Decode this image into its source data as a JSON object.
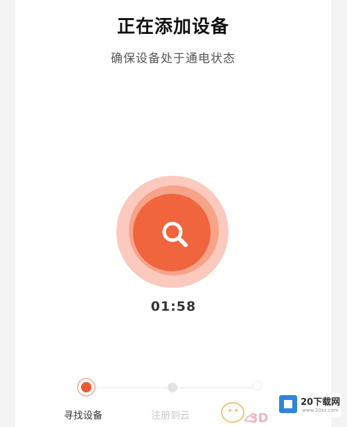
{
  "header": {
    "title": "正在添加设备",
    "subtitle": "确保设备处于通电状态"
  },
  "scanner": {
    "icon": "search-icon",
    "timer": "01:58",
    "colors": {
      "core": "#f0643e",
      "halo": "#fbc9bd"
    }
  },
  "steps": {
    "items": [
      {
        "label": "寻找设备",
        "state": "active"
      },
      {
        "label": "注册到云",
        "state": "pending"
      },
      {
        "label": "",
        "state": "pending"
      }
    ]
  },
  "watermark": {
    "brand": "20下载网",
    "url": "www.20xz.com",
    "icon": "cube-logo-icon"
  }
}
